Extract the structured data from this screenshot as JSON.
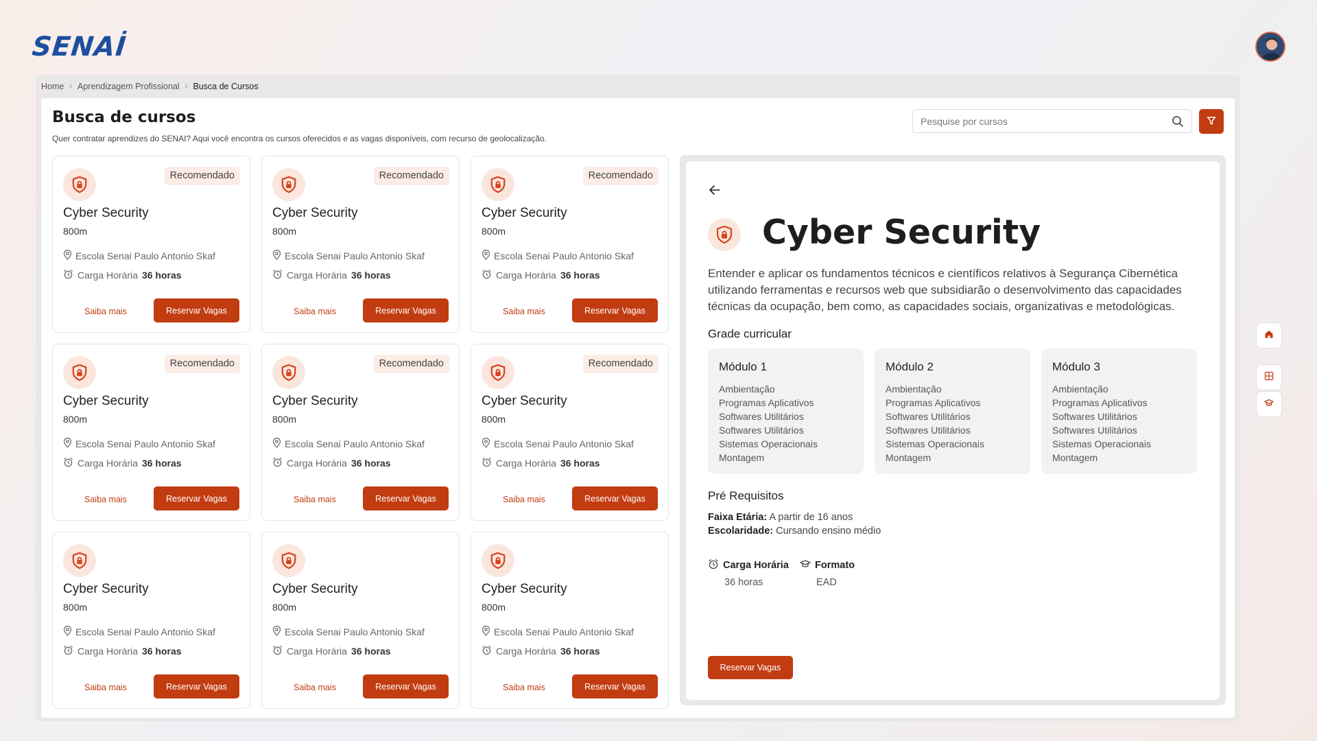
{
  "header": {
    "logo_text": "SENAİ",
    "avatar": "user-avatar"
  },
  "breadcrumb": {
    "items": [
      "Home",
      "Aprendizagem Profissional",
      "Busca de Cursos"
    ]
  },
  "page": {
    "title": "Busca de cursos",
    "subtitle": "Quer contratar aprendizes do SENAI? Aqui você encontra os cursos oferecidos e as vagas disponíveis, com recurso de geolocalização."
  },
  "search": {
    "placeholder": "Pesquise por cursos",
    "icon": "search-icon",
    "filter_icon": "filter-icon"
  },
  "colors": {
    "accent": "#c23c12",
    "accent_soft": "#fbe6de",
    "logo": "#1d4f9f"
  },
  "cards": [
    {
      "badge": "Recomendado",
      "title": "Cyber Security",
      "distance": "800m",
      "school": "Escola Senai Paulo Antonio Skaf",
      "hours_label": "Carga Horária",
      "hours_value": "36 horas",
      "more": "Saiba mais",
      "reserve": "Reservar Vagas"
    },
    {
      "badge": "Recomendado",
      "title": "Cyber Security",
      "distance": "800m",
      "school": "Escola Senai Paulo Antonio Skaf",
      "hours_label": "Carga Horária",
      "hours_value": "36 horas",
      "more": "Saiba mais",
      "reserve": "Reservar Vagas"
    },
    {
      "badge": "Recomendado",
      "title": "Cyber Security",
      "distance": "800m",
      "school": "Escola Senai Paulo Antonio Skaf",
      "hours_label": "Carga Horária",
      "hours_value": "36 horas",
      "more": "Saiba mais",
      "reserve": "Reservar Vagas"
    },
    {
      "badge": "Recomendado",
      "title": "Cyber Security",
      "distance": "800m",
      "school": "Escola Senai Paulo Antonio Skaf",
      "hours_label": "Carga Horária",
      "hours_value": "36 horas",
      "more": "Saiba mais",
      "reserve": "Reservar Vagas"
    },
    {
      "badge": "Recomendado",
      "title": "Cyber Security",
      "distance": "800m",
      "school": "Escola Senai Paulo Antonio Skaf",
      "hours_label": "Carga Horária",
      "hours_value": "36 horas",
      "more": "Saiba mais",
      "reserve": "Reservar Vagas"
    },
    {
      "badge": "Recomendado",
      "title": "Cyber Security",
      "distance": "800m",
      "school": "Escola Senai Paulo Antonio Skaf",
      "hours_label": "Carga Horária",
      "hours_value": "36 horas",
      "more": "Saiba mais",
      "reserve": "Reservar Vagas"
    },
    {
      "badge": "",
      "title": "Cyber Security",
      "distance": "800m",
      "school": "Escola Senai Paulo Antonio Skaf",
      "hours_label": "Carga Horária",
      "hours_value": "36 horas",
      "more": "Saiba mais",
      "reserve": "Reservar Vagas"
    },
    {
      "badge": "",
      "title": "Cyber Security",
      "distance": "800m",
      "school": "Escola Senai Paulo Antonio Skaf",
      "hours_label": "Carga Horária",
      "hours_value": "36 horas",
      "more": "Saiba mais",
      "reserve": "Reservar Vagas"
    },
    {
      "badge": "",
      "title": "Cyber Security",
      "distance": "800m",
      "school": "Escola Senai Paulo Antonio Skaf",
      "hours_label": "Carga Horária",
      "hours_value": "36 horas",
      "more": "Saiba mais",
      "reserve": "Reservar Vagas"
    }
  ],
  "detail": {
    "title": "Cyber Security",
    "description": "Entender e aplicar os fundamentos técnicos e científicos relativos à Segurança Cibernética utilizando ferramentas e recursos web que subsidiarão o desenvolvimento das capacidades técnicas da ocupação, bem como, as capacidades sociais, organizativas e metodológicas.",
    "curriculum_heading": "Grade curricular",
    "modules": [
      {
        "title": "Módulo  1",
        "items": [
          "Ambientação",
          "Programas Aplicativos",
          "Softwares Utilitários",
          "Softwares Utilitários",
          "Sistemas Operacionais",
          "Montagem"
        ]
      },
      {
        "title": "Módulo  2",
        "items": [
          "Ambientação",
          "Programas Aplicativos",
          "Softwares Utilitários",
          "Softwares Utilitários",
          "Sistemas Operacionais",
          "Montagem"
        ]
      },
      {
        "title": "Módulo  3",
        "items": [
          "Ambientação",
          "Programas Aplicativos",
          "Softwares Utilitários",
          "Softwares Utilitários",
          "Sistemas Operacionais",
          "Montagem"
        ]
      }
    ],
    "prereq_heading": "Pré Requisitos",
    "age_label": "Faixa Etária:",
    "age_value": "A partir de 16 anos",
    "school_label": "Escolaridade:",
    "school_value": "Cursando ensino médio",
    "hours_label": "Carga Horária",
    "hours_value": "36 horas",
    "format_label": "Formato",
    "format_value": "EAD",
    "reserve": "Reservar Vagas"
  },
  "side_nav": [
    "home-icon",
    "calculator-icon",
    "graduation-cap-icon"
  ]
}
